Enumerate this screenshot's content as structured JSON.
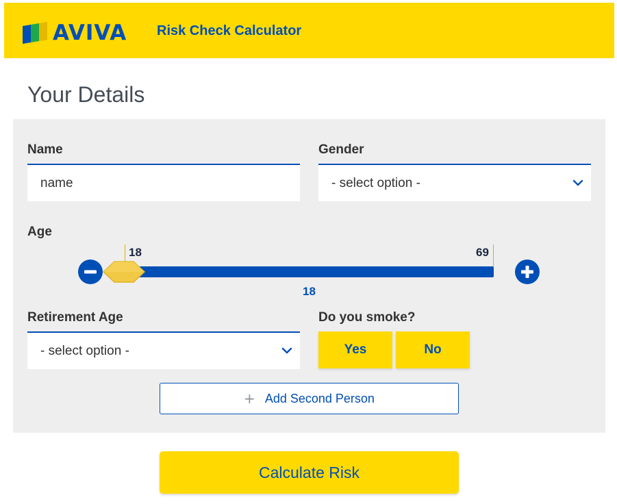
{
  "header": {
    "logo_text": "AVIVA",
    "app_title": "Risk Check Calculator",
    "background_color": "#FFD900",
    "brand_color": "#004FB6"
  },
  "page": {
    "title": "Your Details"
  },
  "form": {
    "name": {
      "label": "Name",
      "value": "name"
    },
    "gender": {
      "label": "Gender",
      "selected": "- select option -"
    },
    "age": {
      "label": "Age",
      "min_label": "18",
      "max_label": "69",
      "value": "18",
      "decrease_icon": "minus-circle-icon",
      "increase_icon": "plus-circle-icon"
    },
    "retirement_age": {
      "label": "Retirement Age",
      "selected": "- select option -"
    },
    "smoke": {
      "label": "Do you smoke?",
      "yes_label": "Yes",
      "no_label": "No"
    },
    "add_second_person_label": "Add Second Person",
    "add_icon": "plus-icon"
  },
  "actions": {
    "calculate_label": "Calculate Risk"
  }
}
